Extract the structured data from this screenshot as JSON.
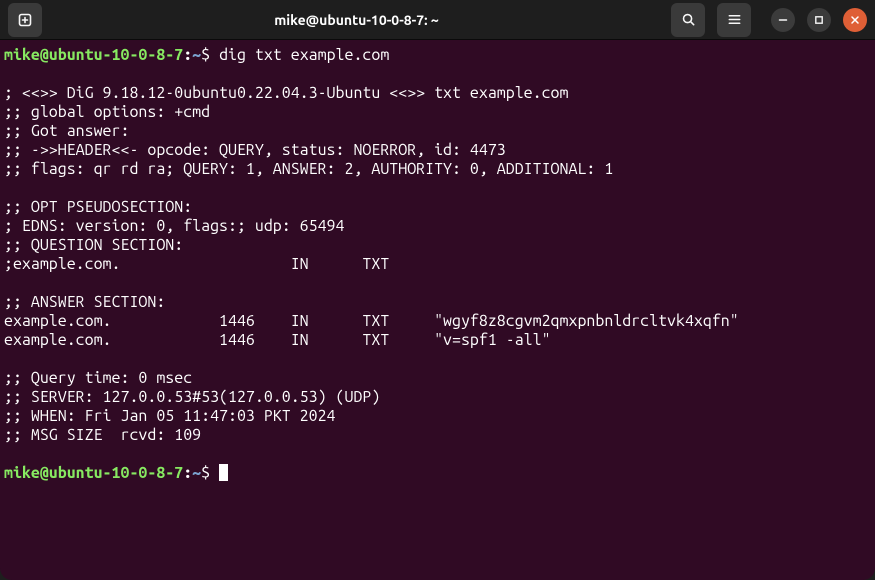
{
  "titlebar": {
    "title": "mike@ubuntu-10-0-8-7: ~"
  },
  "prompt": {
    "user_host": "mike@ubuntu-10-0-8-7",
    "separator": ":",
    "path": "~",
    "end": "$ "
  },
  "command": "dig txt example.com",
  "output_lines": [
    "",
    "; <<>> DiG 9.18.12-0ubuntu0.22.04.3-Ubuntu <<>> txt example.com",
    ";; global options: +cmd",
    ";; Got answer:",
    ";; ->>HEADER<<- opcode: QUERY, status: NOERROR, id: 4473",
    ";; flags: qr rd ra; QUERY: 1, ANSWER: 2, AUTHORITY: 0, ADDITIONAL: 1",
    "",
    ";; OPT PSEUDOSECTION:",
    "; EDNS: version: 0, flags:; udp: 65494",
    ";; QUESTION SECTION:",
    ";example.com.                   IN      TXT",
    "",
    ";; ANSWER SECTION:",
    "example.com.            1446    IN      TXT     \"wgyf8z8cgvm2qmxpnbnldrcltvk4xqfn\"",
    "example.com.            1446    IN      TXT     \"v=spf1 -all\"",
    "",
    ";; Query time: 0 msec",
    ";; SERVER: 127.0.0.53#53(127.0.0.53) (UDP)",
    ";; WHEN: Fri Jan 05 11:47:03 PKT 2024",
    ";; MSG SIZE  rcvd: 109",
    ""
  ]
}
